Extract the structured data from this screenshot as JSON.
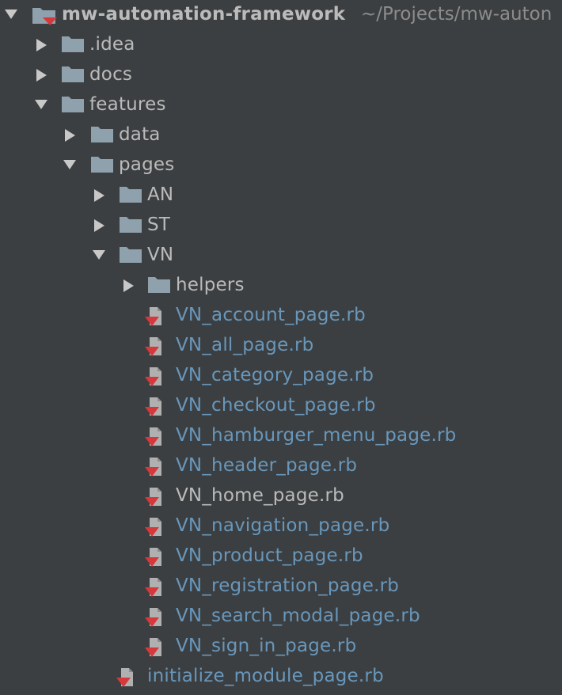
{
  "project": {
    "root_name": "mw-automation-framework",
    "root_path": "~/Projects/mw-auton"
  },
  "tree": {
    "idea": ".idea",
    "docs": "docs",
    "features": "features",
    "data": "data",
    "pages": "pages",
    "an": "AN",
    "st": "ST",
    "vn": "VN",
    "helpers": "helpers",
    "files": [
      "VN_account_page.rb",
      "VN_all_page.rb",
      "VN_category_page.rb",
      "VN_checkout_page.rb",
      "VN_hamburger_menu_page.rb",
      "VN_header_page.rb",
      "VN_home_page.rb",
      "VN_navigation_page.rb",
      "VN_product_page.rb",
      "VN_registration_page.rb",
      "VN_search_modal_page.rb",
      "VN_sign_in_page.rb"
    ],
    "initialize_file": "initialize_module_page.rb"
  },
  "colors": {
    "background": "#3c3f41",
    "text": "#bbbbbb",
    "modified_text": "#6897bb",
    "folder": "#8fa1ad",
    "ruby_badge": "#d7383b"
  },
  "icons": {
    "expanded": "chevron-down-icon",
    "collapsed": "chevron-right-icon",
    "folder": "folder-icon",
    "ruby_file": "ruby-file-icon",
    "module": "module-folder-icon"
  }
}
